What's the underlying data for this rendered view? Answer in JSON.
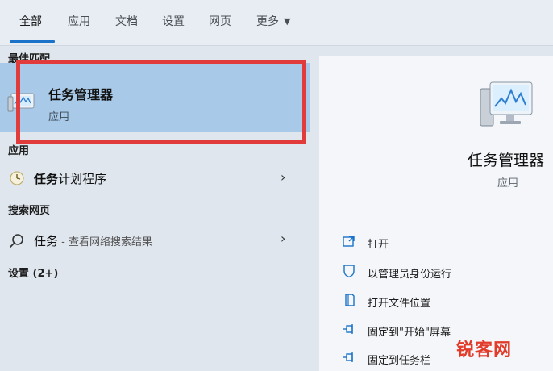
{
  "tabs": [
    {
      "label": "全部",
      "active": true
    },
    {
      "label": "应用"
    },
    {
      "label": "文档"
    },
    {
      "label": "设置"
    },
    {
      "label": "网页"
    },
    {
      "label": "更多"
    }
  ],
  "sections": {
    "best_match": "最佳匹配",
    "apps": "应用",
    "search_web": "搜索网页",
    "settings": "设置 (2+)"
  },
  "best_match": {
    "title": "任务管理器",
    "subtitle": "应用",
    "icon": "task-manager-icon",
    "highlight_color": "#e23b3b"
  },
  "apps": [
    {
      "bold": "任务",
      "rest": "计划程序",
      "icon": "task-scheduler-icon"
    }
  ],
  "web": {
    "bold": "任务",
    "rest": " - 查看网络搜索结果",
    "icon": "search-icon"
  },
  "detail": {
    "title": "任务管理器",
    "subtitle": "应用",
    "actions": [
      {
        "label": "打开",
        "icon": "open-icon"
      },
      {
        "label": "以管理员身份运行",
        "icon": "shield-icon"
      },
      {
        "label": "打开文件位置",
        "icon": "folder-icon"
      },
      {
        "label": "固定到\"开始\"屏幕",
        "icon": "pin-icon"
      },
      {
        "label": "固定到任务栏",
        "icon": "pin-icon"
      }
    ]
  },
  "watermark": "锐客网",
  "colors": {
    "accent": "#1a73c8",
    "selection": "#a8c9e8",
    "highlight": "#e23b3b",
    "watermark": "#e23b2a"
  }
}
